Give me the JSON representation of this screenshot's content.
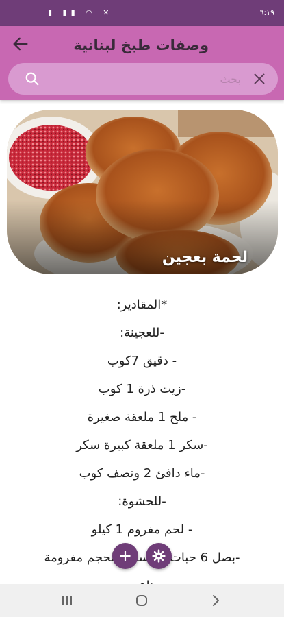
{
  "status_bar": {
    "time": "٦:١٩"
  },
  "app_bar": {
    "title": "وصفات طبخ لبنانية"
  },
  "search": {
    "placeholder": "بحث"
  },
  "hero": {
    "caption": "لحمة بعجين"
  },
  "recipe": {
    "lines": [
      "*المقادير:",
      "-للعجينة:",
      "- دقيق 7كوب",
      "-زيت ذرة 1 كوب",
      "- ملح 1 ملعقة صغيرة",
      "-سكر 1 ملعقة كبيرة سكر",
      "-ماء دافئ 2 ونصف كوب",
      "-للحشوة:",
      "- لحم مفروم 1 كيلو",
      "-بصل 6 حبات متوسطة الحجم مفرومة",
      "ناعم"
    ]
  },
  "colors": {
    "status_bar": "#6f3d78",
    "app_bar": "#c868b2",
    "search_box": "#d99ad0",
    "fab": "#6f3d78"
  },
  "icons": {
    "back": "arrow-left-icon",
    "search": "search-icon",
    "clear": "close-icon",
    "add": "plus-icon",
    "settings": "gear-icon"
  }
}
